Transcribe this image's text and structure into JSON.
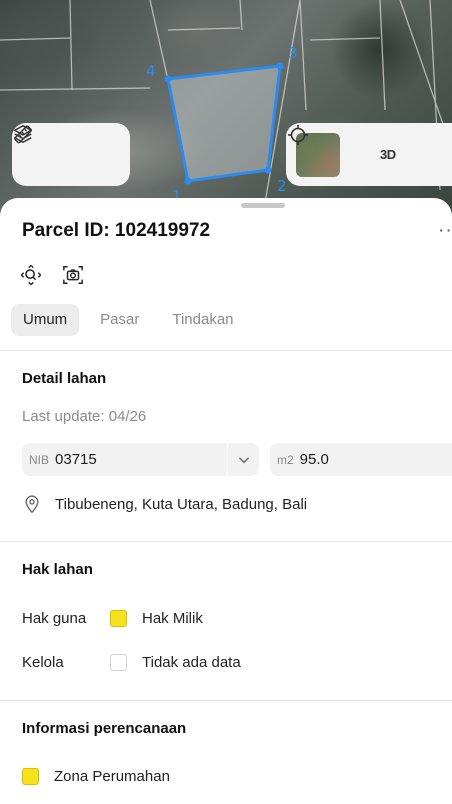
{
  "map": {
    "vertex_labels": [
      "1",
      "2",
      "3",
      "4"
    ],
    "polygon_color": "#2a8cf0",
    "controls": {
      "layers_icon": "layers-icon",
      "measure_icon": "ruler-icon",
      "satellite_icon": "satellite-thumbnail",
      "locate_icon": "crosshair-icon",
      "mode_3d_label": "3D"
    }
  },
  "parcel": {
    "title": "Parcel ID: 102419972",
    "more_label": "··",
    "tools": [
      "zoom-to-parcel-icon",
      "screenshot-icon"
    ]
  },
  "tabs": [
    {
      "label": "Umum",
      "active": true
    },
    {
      "label": "Pasar",
      "active": false
    },
    {
      "label": "Tindakan",
      "active": false
    }
  ],
  "detail": {
    "heading": "Detail lahan",
    "last_update": "Last update: 04/26",
    "nib_prefix": "NIB",
    "nib_value": "03715",
    "area_prefix": "m2",
    "area_value": "95.0",
    "location": "Tibubeneng, Kuta Utara, Badung, Bali"
  },
  "rights": {
    "heading": "Hak lahan",
    "rows": [
      {
        "label": "Hak guna",
        "value": "Hak Milik",
        "color": "#f5e21c"
      },
      {
        "label": "Kelola",
        "value": "Tidak ada data",
        "color": "#ffffff"
      }
    ]
  },
  "planning": {
    "heading": "Informasi perencanaan",
    "zone": "Zona Perumahan",
    "zone_color": "#f5e21c"
  }
}
